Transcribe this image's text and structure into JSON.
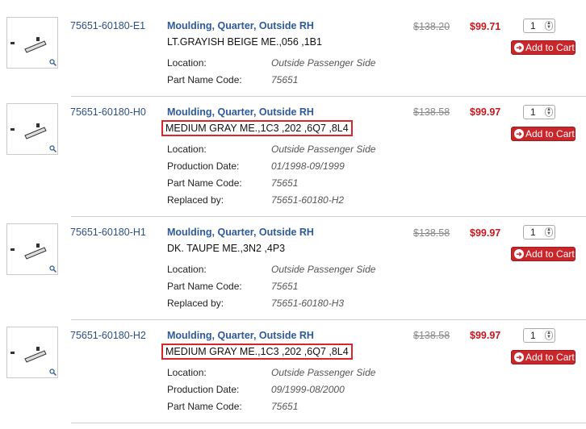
{
  "items": [
    {
      "part_number": "75651-60180-E1",
      "title": "Moulding, Quarter, Outside RH",
      "description": "LT.GRAYISH BEIGE ME.,056 ,1B1",
      "details": [
        {
          "label": "Location:",
          "value": "Outside Passenger Side"
        },
        {
          "label": "Part Name Code:",
          "value": "75651"
        }
      ],
      "list_price": "$138.20",
      "sale_price": "$99.71",
      "quantity": "1",
      "cart_label": "Add to Cart"
    },
    {
      "part_number": "75651-60180-H0",
      "title": "Moulding, Quarter, Outside RH",
      "description": "MEDIUM GRAY ME.,1C3 ,202 ,6Q7 ,8L4",
      "details": [
        {
          "label": "Location:",
          "value": "Outside Passenger Side"
        },
        {
          "label": "Production Date:",
          "value": "01/1998-09/1999"
        },
        {
          "label": "Part Name Code:",
          "value": "75651"
        },
        {
          "label": "Replaced by:",
          "value": "75651-60180-H2"
        }
      ],
      "list_price": "$138.58",
      "sale_price": "$99.97",
      "quantity": "1",
      "cart_label": "Add to Cart"
    },
    {
      "part_number": "75651-60180-H1",
      "title": "Moulding, Quarter, Outside RH",
      "description": "DK. TAUPE ME.,3N2 ,4P3",
      "details": [
        {
          "label": "Location:",
          "value": "Outside Passenger Side"
        },
        {
          "label": "Part Name Code:",
          "value": "75651"
        },
        {
          "label": "Replaced by:",
          "value": "75651-60180-H3"
        }
      ],
      "list_price": "$138.58",
      "sale_price": "$99.97",
      "quantity": "1",
      "cart_label": "Add to Cart"
    },
    {
      "part_number": "75651-60180-H2",
      "title": "Moulding, Quarter, Outside RH",
      "description": "MEDIUM GRAY ME.,1C3 ,202 ,6Q7 ,8L4",
      "details": [
        {
          "label": "Location:",
          "value": "Outside Passenger Side"
        },
        {
          "label": "Production Date:",
          "value": "09/1999-08/2000"
        },
        {
          "label": "Part Name Code:",
          "value": "75651"
        }
      ],
      "list_price": "$138.58",
      "sale_price": "$99.97",
      "quantity": "1",
      "cart_label": "Add to Cart"
    }
  ]
}
